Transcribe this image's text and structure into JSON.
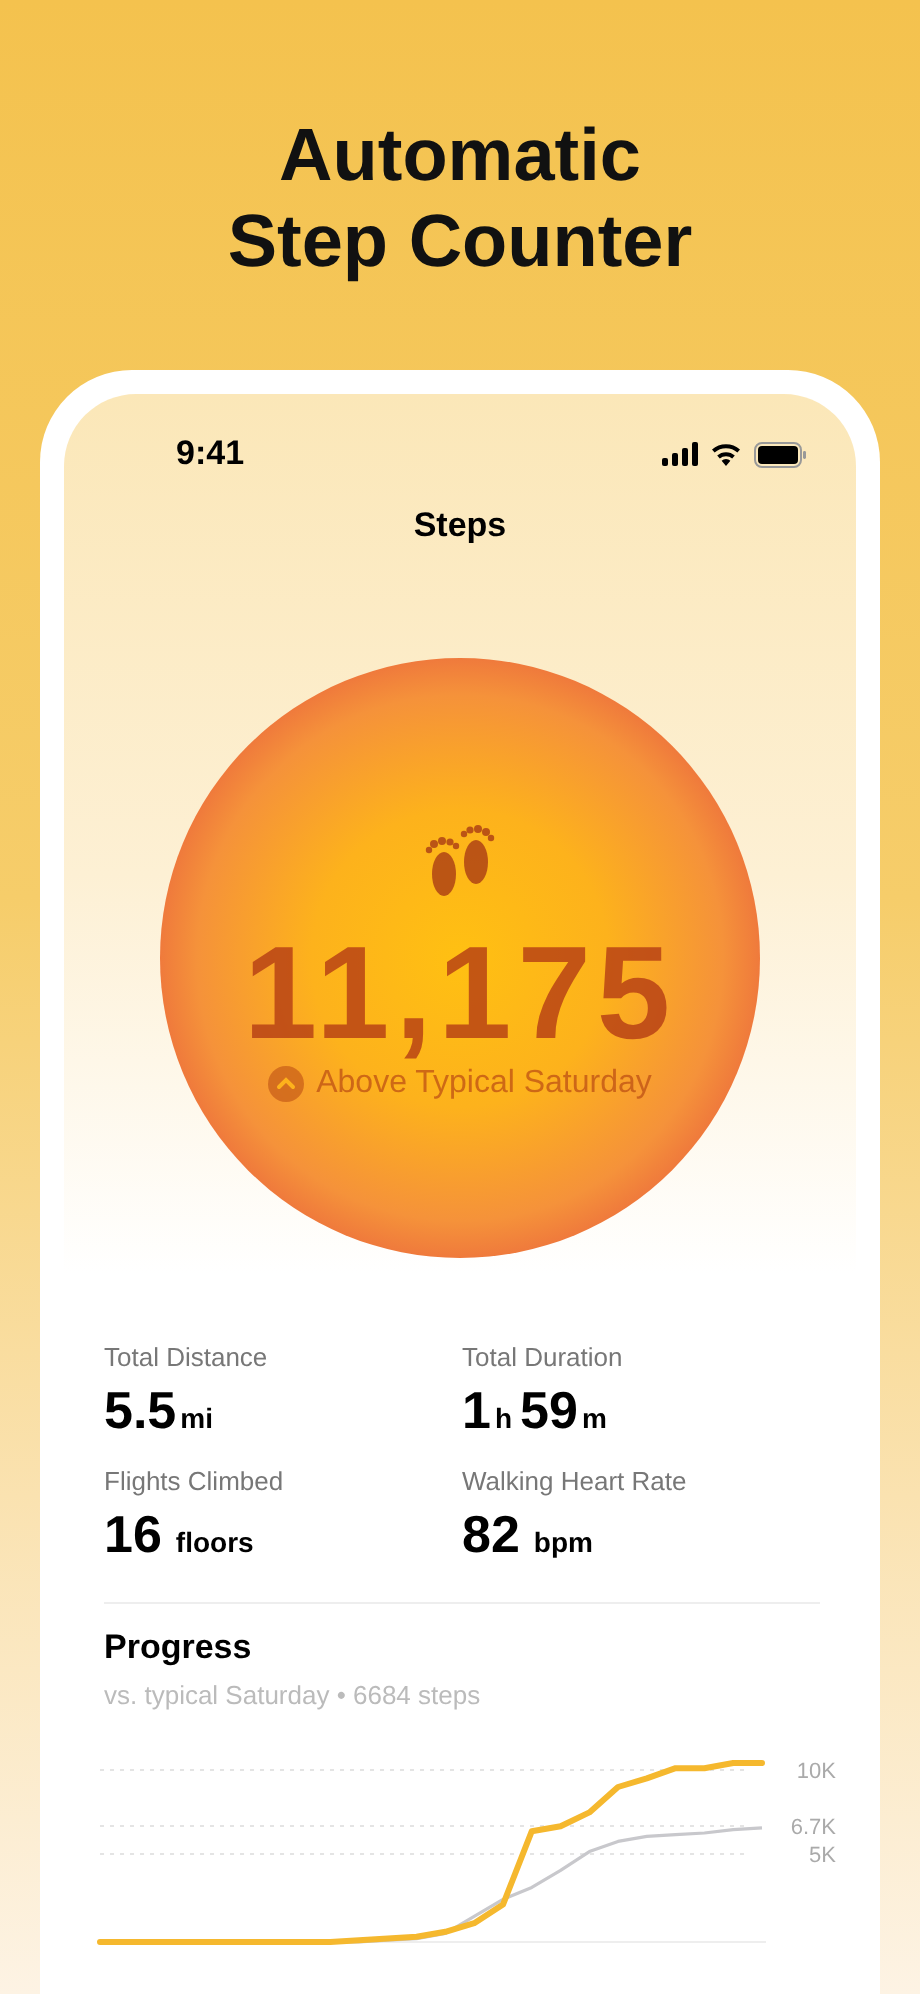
{
  "headline": "Automatic\nStep Counter",
  "status_bar": {
    "time": "9:41"
  },
  "nav_title": "Steps",
  "summary": {
    "steps": "11,175",
    "comparison": "Above Typical Saturday"
  },
  "stats": [
    {
      "label": "Total Distance",
      "parts": [
        {
          "value": "5.5",
          "unit": "mi"
        }
      ]
    },
    {
      "label": "Total Duration",
      "parts": [
        {
          "value": "1",
          "unit": "h"
        },
        {
          "value": "59",
          "unit": "m"
        }
      ]
    },
    {
      "label": "Flights Climbed",
      "parts": [
        {
          "value": "16",
          "unit": "floors"
        }
      ]
    },
    {
      "label": "Walking Heart Rate",
      "parts": [
        {
          "value": "82",
          "unit": "bpm"
        }
      ]
    }
  ],
  "progress": {
    "title": "Progress",
    "subtitle": "vs. typical Saturday • 6684 steps",
    "chart_labels": [
      "10K",
      "6.7K",
      "5K"
    ]
  }
}
